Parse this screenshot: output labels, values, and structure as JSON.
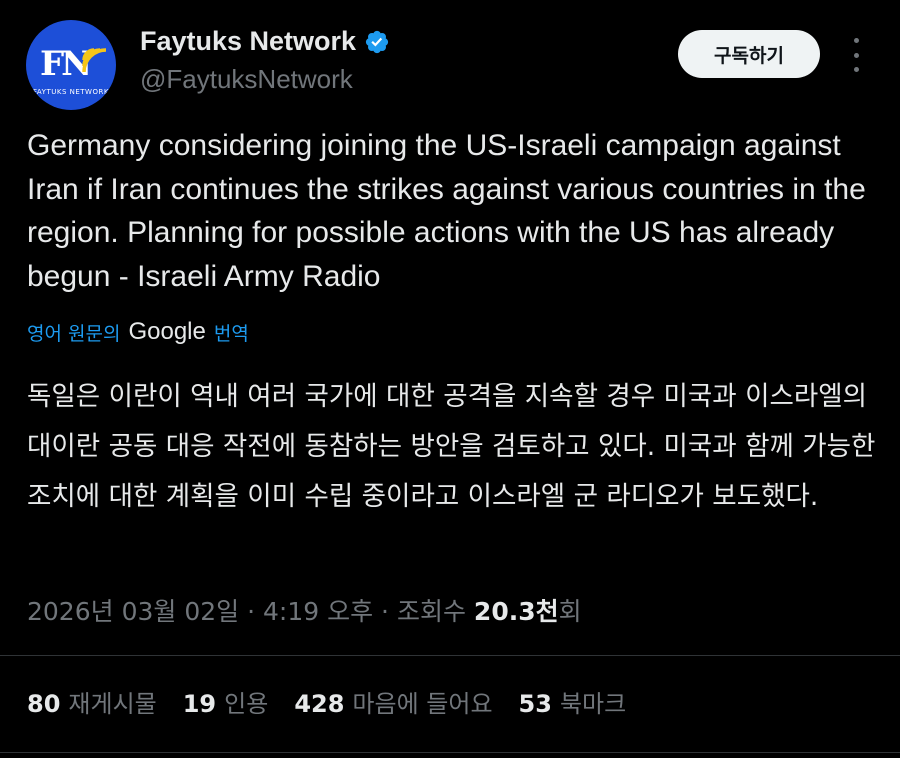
{
  "author": {
    "avatar_text": "FN",
    "avatar_subtext": "FAYTUKS NETWORK",
    "name": "Faytuks Network",
    "handle": "@FaytuksNetwork",
    "verified_color": "#1d9bf0"
  },
  "actions": {
    "subscribe_label": "구독하기",
    "more_icon": "more-vertical-icon"
  },
  "tweet": {
    "text_en": "Germany considering joining the US-Israeli campaign against Iran if Iran continues the strikes against various countries in the region. Planning for possible actions with the US has already begun - Israeli Army Radio",
    "translate_prefix": "영어 원문의",
    "translate_brand": "Google",
    "translate_suffix": "번역",
    "text_ko": "독일은 이란이 역내 여러 국가에 대한 공격을 지속할 경우 미국과 이스라엘의 대이란 공동 대응 작전에 동참하는 방안을 검토하고 있다. 미국과 함께 가능한 조치에 대한 계획을 이미 수립 중이라고 이스라엘 군 라디오가 보도했다."
  },
  "meta": {
    "date": "2026년 03월 02일",
    "sep1": "·",
    "time": "4:19 오후",
    "sep2": "·",
    "views_label": "조회수",
    "views_value": "20.3천",
    "views_suffix": "회"
  },
  "stats": [
    {
      "value": "80",
      "label": "재게시물"
    },
    {
      "value": "19",
      "label": "인용"
    },
    {
      "value": "428",
      "label": "마음에 들어요"
    },
    {
      "value": "53",
      "label": "북마크"
    }
  ],
  "colors": {
    "background": "#000000",
    "accent": "#1d9bf0",
    "text_primary": "#e7e9ea",
    "text_secondary": "#71767b"
  }
}
